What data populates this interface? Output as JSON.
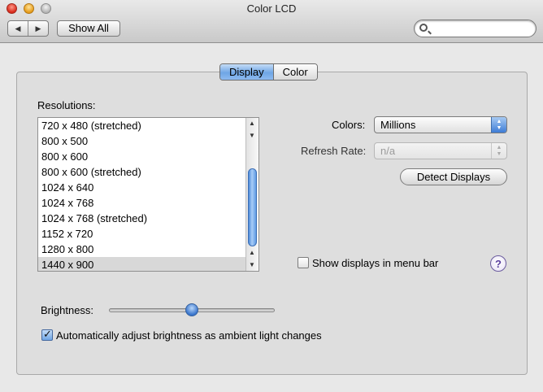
{
  "window": {
    "title": "Color LCD"
  },
  "toolbar": {
    "back_glyph": "◀",
    "forward_glyph": "▶",
    "show_all_label": "Show All",
    "search_placeholder": ""
  },
  "tabs": [
    {
      "label": "Display",
      "active": true
    },
    {
      "label": "Color",
      "active": false
    }
  ],
  "resolutions": {
    "label": "Resolutions:",
    "items": [
      "720 x 480 (stretched)",
      "800 x 500",
      "800 x 600",
      "800 x 600 (stretched)",
      "1024 x 640",
      "1024 x 768",
      "1024 x 768 (stretched)",
      "1152 x 720",
      "1280 x 800",
      "1440 x 900"
    ],
    "selected": "1440 x 900",
    "scroll_up_glyph": "▲",
    "scroll_down_glyph": "▼"
  },
  "colors": {
    "label": "Colors:",
    "value": "Millions"
  },
  "refresh_rate": {
    "label": "Refresh Rate:",
    "value": "n/a",
    "enabled": false
  },
  "detect_displays_label": "Detect Displays",
  "show_in_menu_bar": {
    "label": "Show displays in menu bar",
    "checked": false
  },
  "help_glyph": "?",
  "brightness": {
    "label": "Brightness:",
    "level_fraction": 0.5
  },
  "auto_brightness": {
    "label": "Automatically adjust brightness as ambient light changes",
    "checked": true
  },
  "colors_theme": {
    "accent": "#6fa6e5",
    "selection": "#d8d8d8"
  }
}
